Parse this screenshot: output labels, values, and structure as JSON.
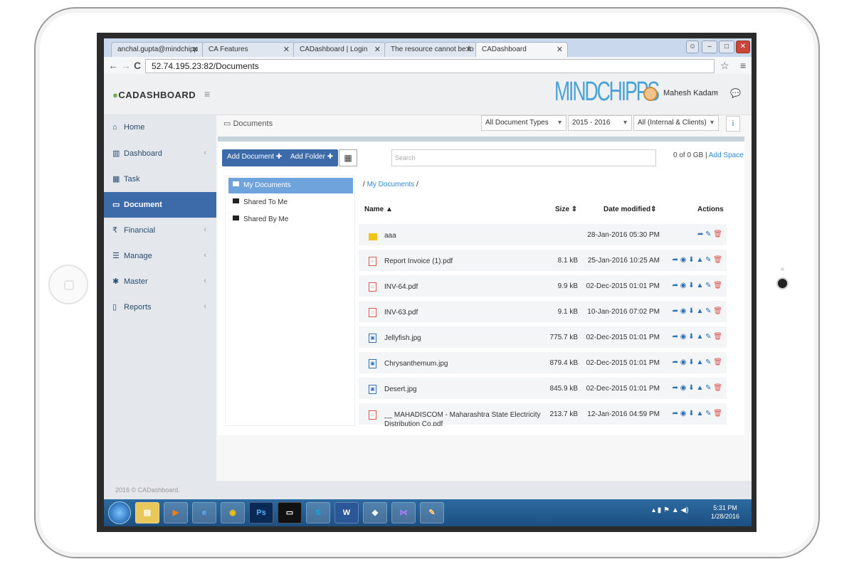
{
  "browser": {
    "tabs": [
      {
        "label": "anchal.gupta@mindchipp"
      },
      {
        "label": "CA Features"
      },
      {
        "label": "CADashboard | Login"
      },
      {
        "label": "The resource cannot be fo"
      },
      {
        "label": "CADashboard"
      }
    ],
    "url": "52.74.195.23:82/Documents"
  },
  "header": {
    "logo": "CADASHBOARD",
    "brand": "MINDCHIPPS",
    "user": "Mahesh Kadam"
  },
  "sidebar": {
    "items": [
      {
        "label": "Home",
        "icon": "home-icon"
      },
      {
        "label": "Dashboard",
        "icon": "bar-chart-icon"
      },
      {
        "label": "Task",
        "icon": "calendar-icon"
      },
      {
        "label": "Document",
        "icon": "folder-open-icon"
      },
      {
        "label": "Financial",
        "icon": "rupee-icon"
      },
      {
        "label": "Manage",
        "icon": "list-icon"
      },
      {
        "label": "Master",
        "icon": "gear-icon"
      },
      {
        "label": "Reports",
        "icon": "file-pdf-icon"
      }
    ]
  },
  "content": {
    "breadcrumb": "Documents",
    "filters": {
      "doc_type": "All Document Types",
      "year": "2015 - 2016",
      "scope": "All (Internal & Clients)"
    },
    "toolbar": {
      "add_document": "Add Document",
      "add_folder": "Add Folder",
      "search_placeholder": "Search",
      "quota": "0 of 0 GB",
      "add_space": "Add Space"
    },
    "tree": [
      "My Documents",
      "Shared To Me",
      "Shared By Me"
    ],
    "path": "My Documents",
    "columns": {
      "name": "Name",
      "size": "Size",
      "date": "Date modified",
      "actions": "Actions"
    },
    "files": [
      {
        "name": "aaa",
        "size": "",
        "date": "28-Jan-2016 05:30 PM",
        "kind": "folder"
      },
      {
        "name": "Report Invoice (1).pdf",
        "size": "8.1 kB",
        "date": "25-Jan-2016 10:25 AM",
        "kind": "pdf"
      },
      {
        "name": "INV-64.pdf",
        "size": "9.9 kB",
        "date": "02-Dec-2015 01:01 PM",
        "kind": "pdf"
      },
      {
        "name": "INV-63.pdf",
        "size": "9.1 kB",
        "date": "10-Jan-2016 07:02 PM",
        "kind": "pdf"
      },
      {
        "name": "Jellyfish.jpg",
        "size": "775.7 kB",
        "date": "02-Dec-2015 01:01 PM",
        "kind": "image"
      },
      {
        "name": "Chrysanthemum.jpg",
        "size": "879.4 kB",
        "date": "02-Dec-2015 01:01 PM",
        "kind": "image"
      },
      {
        "name": "Desert.jpg",
        "size": "845.9 kB",
        "date": "02-Dec-2015 01:01 PM",
        "kind": "image"
      },
      {
        "name": "__ MAHADISCOM - Maharashtra State Electricity Distribution Co.pdf",
        "size": "213.7 kB",
        "date": "12-Jan-2016 04:59 PM",
        "kind": "pdf"
      }
    ]
  },
  "footer": "2016 © CADashboard.",
  "taskbar": {
    "time": "5:31 PM",
    "date": "1/28/2016"
  }
}
